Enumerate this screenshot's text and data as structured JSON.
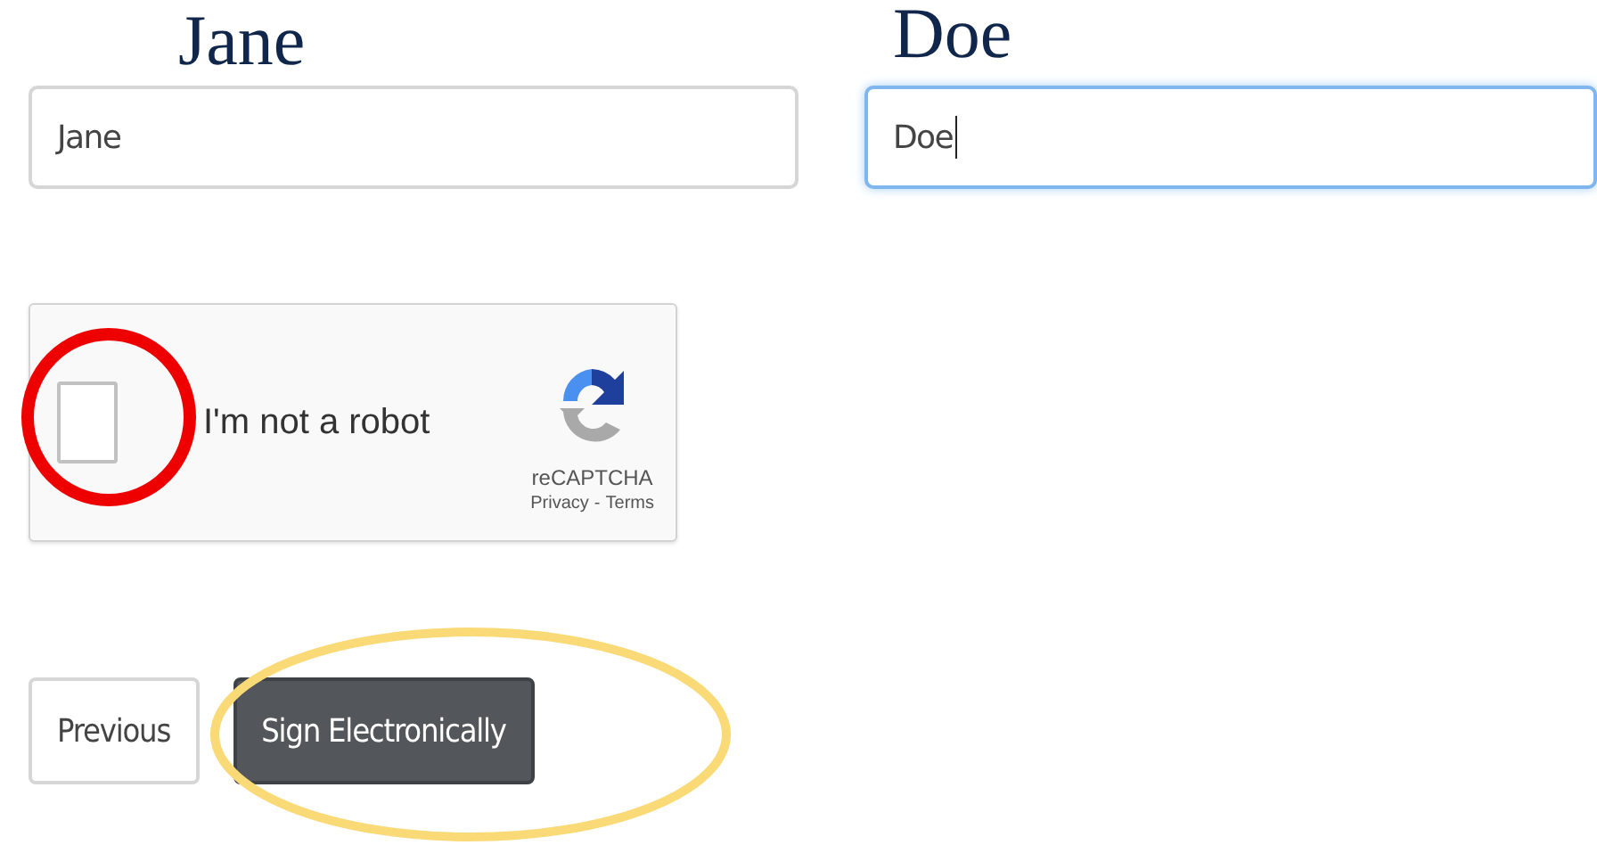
{
  "name_fields": [
    {
      "caption": "Jane",
      "value": "Jane",
      "focused": false
    },
    {
      "caption": "Doe",
      "value": "Doe",
      "focused": true
    }
  ],
  "captcha": {
    "label": "I'm not a robot",
    "checked": false,
    "brand": "reCAPTCHA",
    "links": [
      "Privacy",
      "Terms"
    ],
    "separator": "-"
  },
  "buttons": [
    {
      "label": "Previous",
      "kind": "secondary"
    },
    {
      "label": "Sign Electronically",
      "kind": "primary"
    }
  ],
  "annotations": [
    {
      "kind": "circle"
    },
    {
      "kind": "ellipse"
    }
  ]
}
